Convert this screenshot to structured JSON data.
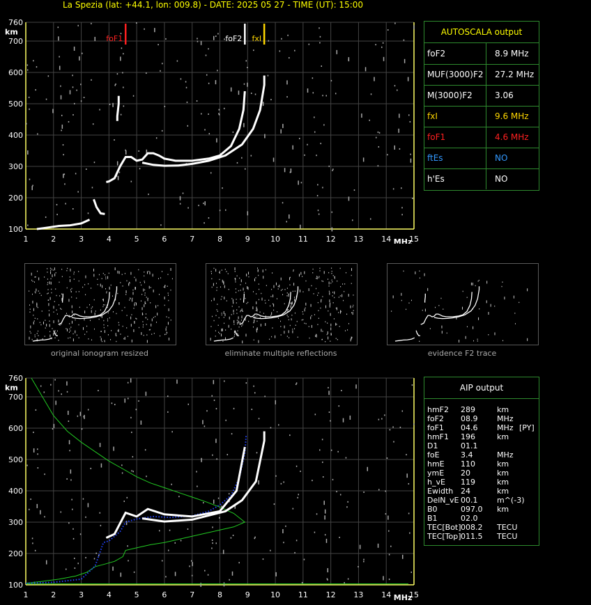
{
  "header": {
    "title": "La Spezia (lat: +44.1, lon: 009.8) - DATE: 2025 05 27 - TIME (UT): 15:00"
  },
  "colors": {
    "accent": "#ffff00",
    "panel_border": "#2e8b2e",
    "fof1": "#ff2020",
    "ftes": "#3399ff",
    "fxl": "#ffd700"
  },
  "autoscala": {
    "title": "AUTOSCALA output",
    "rows": [
      {
        "key": "foF2",
        "value": "8.9 MHz",
        "color": "#ffffff"
      },
      {
        "key": "MUF(3000)F2",
        "value": "27.2 MHz",
        "color": "#ffffff"
      },
      {
        "key": "M(3000)F2",
        "value": "3.06",
        "color": "#ffffff"
      },
      {
        "key": "fxI",
        "value": "9.6 MHz",
        "color": "#ffd700"
      },
      {
        "key": "foF1",
        "value": "4.6 MHz",
        "color": "#ff2020"
      },
      {
        "key": "ftEs",
        "value": "NO",
        "color": "#3399ff"
      },
      {
        "key": "h'Es",
        "value": "NO",
        "color": "#ffffff"
      }
    ]
  },
  "thumbnails": [
    {
      "label": "original ionogram resized"
    },
    {
      "label": "eliminate multiple reflections"
    },
    {
      "label": "evidence F2 trace"
    }
  ],
  "aip": {
    "title": "AIP output",
    "rows": [
      {
        "name": "hmF2",
        "value": "289",
        "unit": "km",
        "extra": ""
      },
      {
        "name": "foF2",
        "value": "08.9",
        "unit": "MHz",
        "extra": ""
      },
      {
        "name": "foF1",
        "value": "04.6",
        "unit": "MHz",
        "extra": "[PY]"
      },
      {
        "name": "hmF1",
        "value": "196",
        "unit": "km",
        "extra": ""
      },
      {
        "name": "D1",
        "value": "01.1",
        "unit": "",
        "extra": ""
      },
      {
        "name": "foE",
        "value": "3.4",
        "unit": "MHz",
        "extra": ""
      },
      {
        "name": "hmE",
        "value": "110",
        "unit": "km",
        "extra": ""
      },
      {
        "name": "ymE",
        "value": "20",
        "unit": "km",
        "extra": ""
      },
      {
        "name": "h_vE",
        "value": "119",
        "unit": "km",
        "extra": ""
      },
      {
        "name": "Ewidth",
        "value": "24",
        "unit": "km",
        "extra": ""
      },
      {
        "name": "DelN_vE",
        "value": "00.1",
        "unit": "m^(-3)",
        "extra": ""
      },
      {
        "name": "B0",
        "value": "097.0",
        "unit": "km",
        "extra": ""
      },
      {
        "name": "B1",
        "value": "02.0",
        "unit": "",
        "extra": ""
      },
      {
        "name": "TEC[Bot]",
        "value": "008.2",
        "unit": "TECU",
        "extra": ""
      },
      {
        "name": "TEC[Top]",
        "value": "011.5",
        "unit": "TECU",
        "extra": ""
      }
    ]
  },
  "chart_data": [
    {
      "type": "scatter",
      "xlabel": "MHz",
      "ylabel": "km",
      "xlim": [
        1,
        15
      ],
      "ylim": [
        100,
        760
      ],
      "xticks": [
        "1",
        "2",
        "3",
        "4",
        "5",
        "6",
        "7",
        "8",
        "9",
        "10",
        "11",
        "12",
        "13",
        "14",
        "15"
      ],
      "yticks": [
        "100",
        "200",
        "300",
        "400",
        "500",
        "600",
        "700",
        "760"
      ],
      "grid": true,
      "markers": [
        {
          "label": "foF1",
          "x": 4.6,
          "color": "#ff2020"
        },
        {
          "label": "foF2",
          "x": 8.9,
          "color": "#ffffff"
        },
        {
          "label": "fxI",
          "x": 9.6,
          "color": "#ffd700"
        }
      ],
      "series": [
        {
          "color": "#ffffff",
          "points": [
            [
              1.4,
              100
            ],
            [
              1.8,
              105
            ],
            [
              2.2,
              110
            ],
            [
              2.6,
              112
            ],
            [
              3.0,
              118
            ],
            [
              3.3,
              130
            ]
          ]
        },
        {
          "color": "#ffffff",
          "points": [
            [
              3.45,
              195
            ],
            [
              3.55,
              170
            ],
            [
              3.7,
              150
            ],
            [
              3.85,
              148
            ]
          ]
        },
        {
          "color": "#ffffff",
          "points": [
            [
              3.9,
              250
            ],
            [
              4.0,
              252
            ],
            [
              4.2,
              262
            ],
            [
              4.4,
              300
            ],
            [
              4.6,
              330
            ],
            [
              4.8,
              330
            ],
            [
              5.0,
              318
            ],
            [
              5.2,
              322
            ],
            [
              5.4,
              342
            ],
            [
              5.6,
              342
            ],
            [
              5.8,
              335
            ],
            [
              6.0,
              325
            ],
            [
              6.4,
              318
            ],
            [
              7.0,
              318
            ],
            [
              7.6,
              325
            ],
            [
              8.0,
              335
            ],
            [
              8.4,
              365
            ],
            [
              8.7,
              420
            ],
            [
              8.85,
              480
            ],
            [
              8.9,
              540
            ]
          ]
        },
        {
          "color": "#ffffff",
          "points": [
            [
              5.2,
              312
            ],
            [
              5.6,
              305
            ],
            [
              6.0,
              302
            ],
            [
              6.5,
              303
            ],
            [
              7.0,
              308
            ],
            [
              7.6,
              318
            ],
            [
              8.2,
              335
            ],
            [
              8.8,
              370
            ],
            [
              9.2,
              420
            ],
            [
              9.45,
              480
            ],
            [
              9.6,
              560
            ],
            [
              9.6,
              590
            ]
          ]
        },
        {
          "color": "#ffffff",
          "points": [
            [
              4.3,
              445
            ],
            [
              4.3,
              460
            ],
            [
              4.35,
              500
            ],
            [
              4.35,
              525
            ]
          ]
        }
      ]
    },
    {
      "type": "line",
      "xlabel": "MHz",
      "ylabel": "km",
      "xlim": [
        1,
        15
      ],
      "ylim": [
        100,
        760
      ],
      "xticks": [
        "1",
        "2",
        "3",
        "4",
        "5",
        "6",
        "7",
        "8",
        "9",
        "10",
        "11",
        "12",
        "13",
        "14",
        "15"
      ],
      "yticks": [
        "100",
        "200",
        "300",
        "400",
        "500",
        "600",
        "700",
        "760"
      ],
      "grid": true,
      "series": [
        {
          "color": "#22cc22",
          "points": [
            [
              1.2,
              760
            ],
            [
              1.6,
              700
            ],
            [
              2.0,
              640
            ],
            [
              2.5,
              590
            ],
            [
              3.0,
              555
            ],
            [
              3.5,
              525
            ],
            [
              4.0,
              495
            ],
            [
              4.5,
              470
            ],
            [
              5.0,
              445
            ],
            [
              5.5,
              425
            ],
            [
              6.0,
              410
            ],
            [
              6.5,
              395
            ],
            [
              7.0,
              380
            ],
            [
              7.5,
              365
            ],
            [
              8.0,
              348
            ],
            [
              8.5,
              328
            ],
            [
              8.9,
              300
            ],
            [
              8.5,
              285
            ],
            [
              8.0,
              275
            ],
            [
              7.5,
              265
            ],
            [
              7.0,
              255
            ],
            [
              6.5,
              245
            ],
            [
              6.0,
              235
            ],
            [
              5.5,
              228
            ],
            [
              5.0,
              218
            ],
            [
              4.6,
              210
            ],
            [
              4.5,
              190
            ],
            [
              4.2,
              175
            ],
            [
              3.8,
              165
            ],
            [
              3.5,
              158
            ],
            [
              3.2,
              140
            ],
            [
              2.8,
              128
            ],
            [
              2.2,
              118
            ],
            [
              1.5,
              110
            ],
            [
              1.0,
              105
            ]
          ]
        },
        {
          "color": "#22cc22",
          "points": [
            [
              1.0,
              103
            ],
            [
              4.0,
              103
            ],
            [
              8.0,
              103
            ],
            [
              12.0,
              103
            ],
            [
              14.8,
              103
            ]
          ]
        },
        {
          "color": "#2244ff",
          "points": [
            [
              1.0,
              105
            ],
            [
              2.0,
              108
            ],
            [
              3.0,
              118
            ],
            [
              3.5,
              160
            ],
            [
              3.8,
              235
            ],
            [
              4.0,
              240
            ],
            [
              4.4,
              270
            ],
            [
              4.6,
              300
            ],
            [
              5.0,
              310
            ],
            [
              5.6,
              318
            ],
            [
              6.2,
              315
            ],
            [
              7.0,
              320
            ],
            [
              7.6,
              335
            ],
            [
              8.0,
              355
            ],
            [
              8.4,
              385
            ],
            [
              8.7,
              440
            ],
            [
              8.9,
              520
            ],
            [
              8.95,
              580
            ]
          ]
        },
        {
          "color": "#ffffff",
          "points": [
            [
              3.9,
              250
            ],
            [
              4.2,
              262
            ],
            [
              4.6,
              330
            ],
            [
              5.0,
              318
            ],
            [
              5.4,
              342
            ],
            [
              6.0,
              325
            ],
            [
              7.0,
              318
            ],
            [
              8.0,
              335
            ],
            [
              8.6,
              400
            ],
            [
              8.9,
              540
            ]
          ]
        },
        {
          "color": "#ffffff",
          "points": [
            [
              5.2,
              312
            ],
            [
              6.0,
              302
            ],
            [
              7.0,
              308
            ],
            [
              8.2,
              335
            ],
            [
              8.8,
              370
            ],
            [
              9.3,
              430
            ],
            [
              9.6,
              560
            ],
            [
              9.6,
              590
            ]
          ]
        }
      ]
    }
  ]
}
